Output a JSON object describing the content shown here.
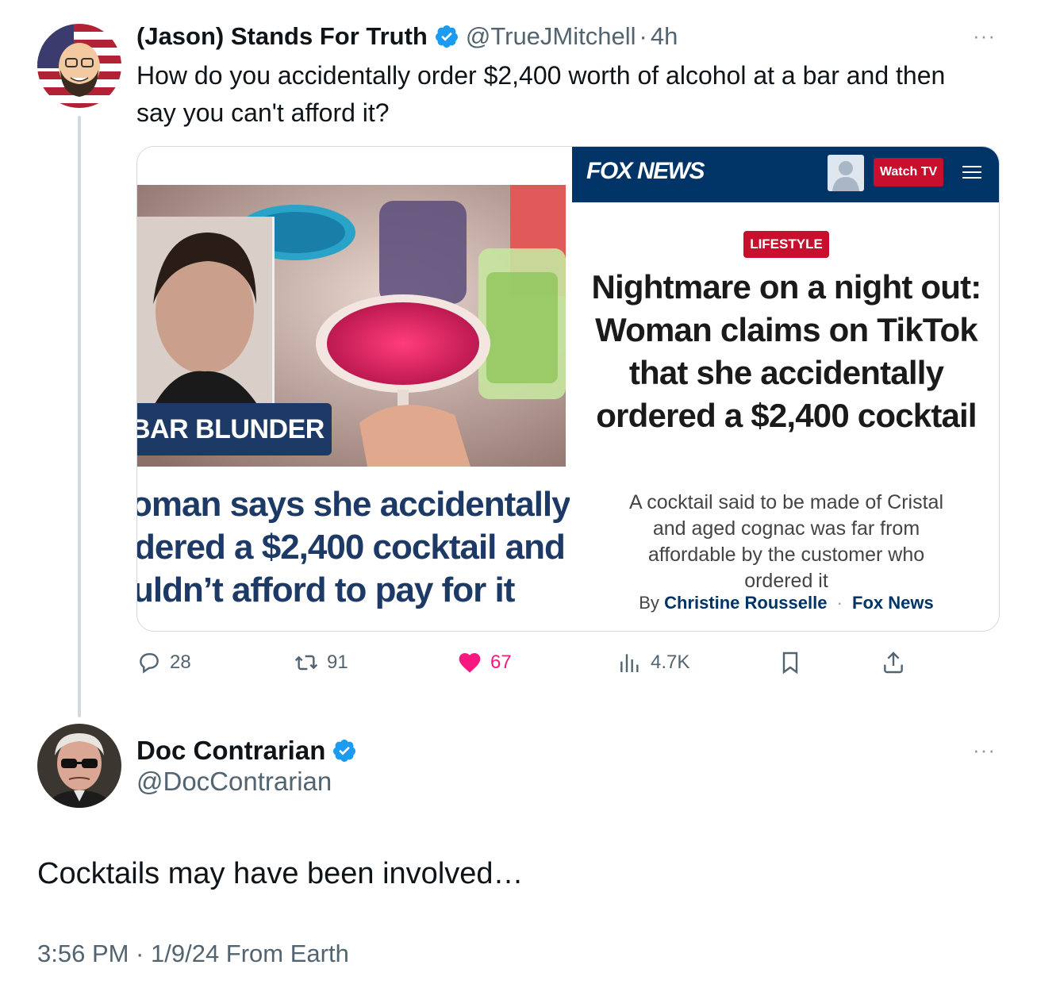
{
  "tweet1": {
    "display_name": "(Jason) Stands For Truth",
    "handle": "@TrueJMitchell",
    "separator": "·",
    "time": "4h",
    "more": "···",
    "text": "How do you accidentally order $2,400 worth of alcohol at a bar and then say you can't afford it?",
    "card": {
      "left": {
        "banner": "BAR BLUNDER",
        "headline_lines": [
          "oman says she accidentally",
          "dered a $2,400 cocktail and",
          "uldn’t afford to pay for it"
        ]
      },
      "right": {
        "logo": "FOX NEWS",
        "watch_button": "Watch TV",
        "category": "LIFESTYLE",
        "headline": "Nightmare on a night out: Woman claims on TikTok that she accidentally ordered a $2,400 cocktail",
        "subheadline": "A cocktail said to be made of Cristal and aged cognac was far from affordable by the customer who ordered it",
        "byline_prefix": "By",
        "author": "Christine Rousselle",
        "byline_sep": "·",
        "outlet": "Fox News"
      }
    },
    "actions": {
      "replies": "28",
      "retweets": "91",
      "likes": "67",
      "views": "4.7K"
    },
    "colors": {
      "like": "#f91880",
      "verified": "#1d9bf0",
      "fox_navy": "#003366",
      "fox_red": "#c8102e"
    }
  },
  "tweet2": {
    "display_name": "Doc Contrarian",
    "handle": "@DocContrarian",
    "more": "···",
    "text": "Cocktails may have been involved…",
    "meta": "3:56 PM · 1/9/24 From Earth"
  }
}
